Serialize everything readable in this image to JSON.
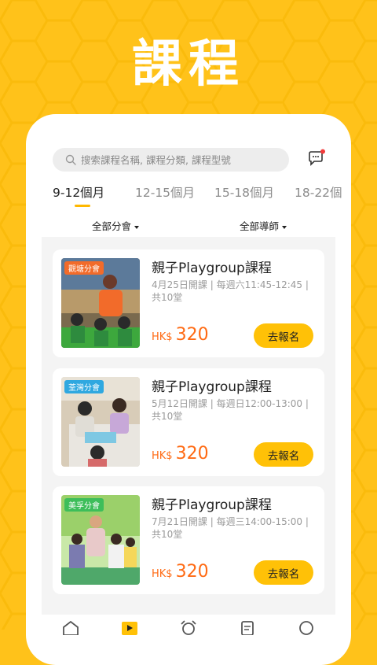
{
  "header": {
    "title": "課程"
  },
  "search": {
    "placeholder": "搜索課程名稱, 課程分類, 課程型號"
  },
  "tabs": [
    "9-12個月",
    "12-15個月",
    "15-18個月",
    "18-22個"
  ],
  "filters": {
    "branch": "全部分會",
    "tutor": "全部導師"
  },
  "courses": [
    {
      "branch": "觀塘分會",
      "badge_color": "#F26B2A",
      "title": "親子Playgroup課程",
      "desc": "4月25日開課 | 每週六11:45-12:45 | 共10堂",
      "currency": "HK$",
      "price": "320",
      "action": "去報名"
    },
    {
      "branch": "荃灣分會",
      "badge_color": "#2FA8E0",
      "title": "親子Playgroup課程",
      "desc": "5月12日開課 | 每週日12:00-13:00 | 共10堂",
      "currency": "HK$",
      "price": "320",
      "action": "去報名"
    },
    {
      "branch": "美孚分會",
      "badge_color": "#3DBE5A",
      "title": "親子Playgroup課程",
      "desc": "7月21日開課 | 每週三14:00-15:00 | 共10堂",
      "currency": "HK$",
      "price": "320",
      "action": "去報名"
    }
  ],
  "colors": {
    "accent": "#FFC21A",
    "price": "#FF6A13",
    "button": "#FFC107"
  },
  "nav": [
    "home-icon",
    "play-icon",
    "alarm-icon",
    "document-icon",
    "chat-icon"
  ]
}
